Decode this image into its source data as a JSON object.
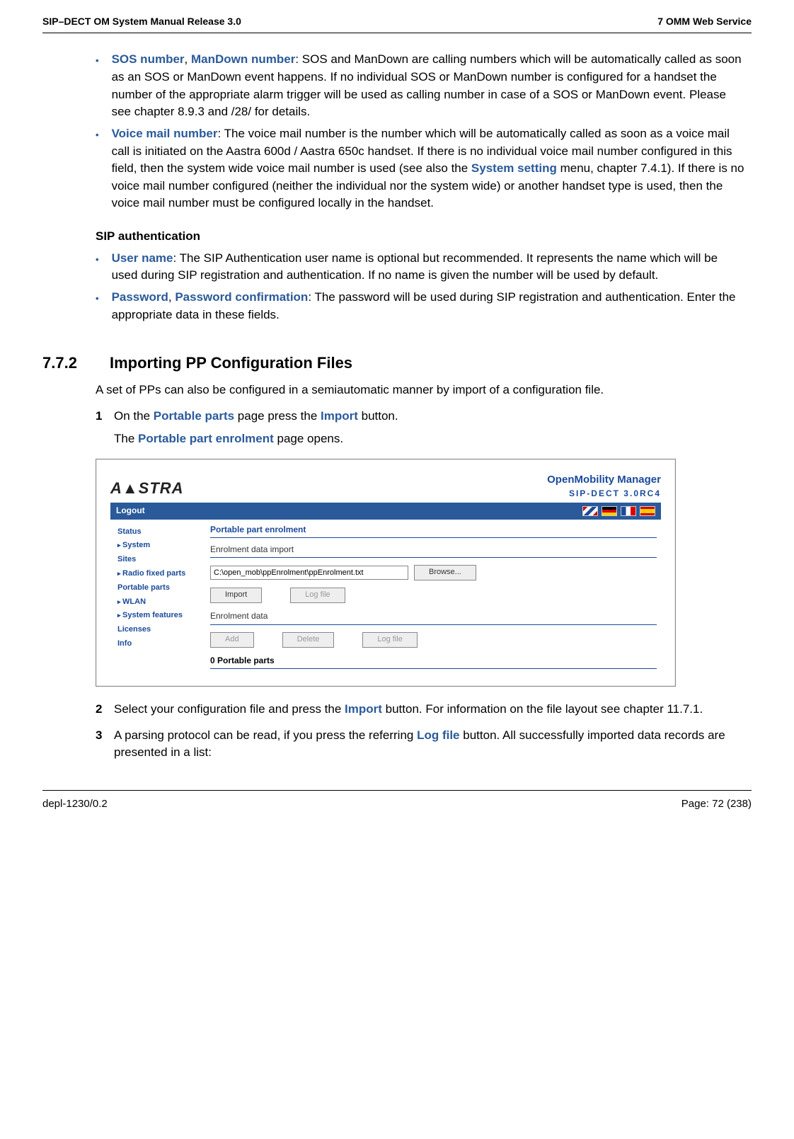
{
  "header": {
    "left": "SIP–DECT OM System Manual Release 3.0",
    "right": "7 OMM Web Service"
  },
  "footer": {
    "left": "depl-1230/0.2",
    "right": "Page: 72 (238)"
  },
  "b1": {
    "term": "SOS number",
    "sep1": ", ",
    "term2": "ManDown number",
    "rest": ": SOS and ManDown are calling numbers which will be automatically called as soon as an SOS or ManDown event happens. If no individual SOS or ManDown number is configured for a handset the number of the appropriate alarm trigger will be used as calling number in case of a SOS or ManDown event. Please see chapter 8.9.3 and /28/ for details."
  },
  "b2": {
    "term": "Voice mail number",
    "pre": ": The voice mail number is the number which will be automatically called as soon as a voice mail call is initiated on the Aastra 600d / Aastra 650c handset. If there is no individual voice mail number configured in this field, then the system wide voice mail number is used (see also the ",
    "link": "System setting",
    "post": " menu, chapter 7.4.1). If there is no voice mail number configured (neither the individual nor the system wide) or another handset type is used, then the voice mail number must be configured locally in the handset."
  },
  "sip_heading": "SIP authentication",
  "b3": {
    "term": "User name",
    "rest": ": The SIP Authentication user name is optional but recommended. It represents the name which will be used during SIP registration and authentication. If no name is given the number will be used by default."
  },
  "b4": {
    "term": "Password",
    "sep1": ", ",
    "term2": "Password confirmation",
    "rest": ": The password will be used during SIP registration and authentication. Enter the appropriate data in these fields."
  },
  "section": {
    "num": "7.7.2",
    "title": "Importing PP Configuration Files"
  },
  "intro": "A set of PPs can also be configured in a semiautomatic manner by import of a configuration file.",
  "step1": {
    "num": "1",
    "pre": "On the ",
    "l1": "Portable parts",
    "mid": " page press the ",
    "l2": "Import",
    "post": " button."
  },
  "step1b": {
    "pre": "The ",
    "l1": "Portable part enrolment",
    "post": " page opens."
  },
  "shot": {
    "logo": "A▲STRA",
    "brand1": "OpenMobility Manager",
    "brand2": "SIP-DECT 3.0RC4",
    "logout": "Logout",
    "nav": {
      "status": "Status",
      "system": "System",
      "sites": "Sites",
      "rfp": "Radio fixed parts",
      "pp": "Portable parts",
      "wlan": "WLAN",
      "sf": "System features",
      "lic": "Licenses",
      "info": "Info"
    },
    "title": "Portable part enrolment",
    "sec1": "Enrolment data import",
    "path": "C:\\open_mob\\ppEnrolment\\ppEnrolment.txt",
    "browse": "Browse...",
    "import": "Import",
    "logfile": "Log file",
    "sec2": "Enrolment data",
    "add": "Add",
    "delete": "Delete",
    "count": "0 Portable parts"
  },
  "step2": {
    "num": "2",
    "pre": "Select your configuration file and press the ",
    "l1": "Import",
    "post": " button. For information on the file layout see chapter 11.7.1."
  },
  "step3": {
    "num": "3",
    "pre": "A parsing protocol can be read, if you press the referring ",
    "l1": "Log file",
    "post": " button. All successfully imported data records are presented in a list:"
  }
}
